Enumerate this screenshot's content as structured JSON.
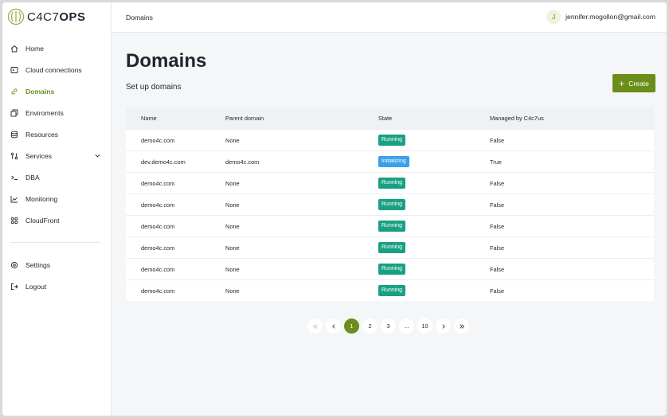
{
  "brand": {
    "name_bold_start": "C4C7",
    "name_bold_end": "OPS",
    "accent": "#6b8e1a"
  },
  "sidebar": {
    "items": [
      {
        "label": "Home",
        "icon": "home-icon"
      },
      {
        "label": "Cloud connections",
        "icon": "cloud-connection-icon"
      },
      {
        "label": "Domains",
        "icon": "link-icon",
        "active": true
      },
      {
        "label": "Enviroments",
        "icon": "environments-icon"
      },
      {
        "label": "Resources",
        "icon": "database-icon"
      },
      {
        "label": "Services",
        "icon": "services-icon",
        "expandable": true
      },
      {
        "label": "DBA",
        "icon": "terminal-icon"
      },
      {
        "label": "Monitoring",
        "icon": "chart-line-icon"
      },
      {
        "label": "CloudFront",
        "icon": "grid-icon"
      }
    ],
    "bottom_items": [
      {
        "label": "Settings",
        "icon": "gear-icon"
      },
      {
        "label": "Logout",
        "icon": "logout-icon"
      }
    ]
  },
  "topbar": {
    "breadcrumb": "Domains",
    "user": {
      "initial": "J",
      "email": "jennifer.mogollon@gmail.com"
    }
  },
  "page": {
    "title": "Domains",
    "subtitle": "Set up domains",
    "create_label": "Create"
  },
  "table": {
    "columns": [
      "Name",
      "Parent domain",
      "State",
      "Managed by C4c7us"
    ],
    "rows": [
      {
        "name": "demo4c.com",
        "parent": "None",
        "state": "Running",
        "managed": "False"
      },
      {
        "name": "dev.demo4c.com",
        "parent": "demo4c.com",
        "state": "Initializing",
        "managed": "True"
      },
      {
        "name": "demo4c.com",
        "parent": "None",
        "state": "Running",
        "managed": "False"
      },
      {
        "name": "demo4c.com",
        "parent": "None",
        "state": "Running",
        "managed": "False"
      },
      {
        "name": "demo4c.com",
        "parent": "None",
        "state": "Running",
        "managed": "False"
      },
      {
        "name": "demo4c.com",
        "parent": "None",
        "state": "Running",
        "managed": "False"
      },
      {
        "name": "demo4c.com",
        "parent": "None",
        "state": "Running",
        "managed": "False"
      },
      {
        "name": "demo4c.com",
        "parent": "None",
        "state": "Running",
        "managed": "False"
      }
    ],
    "status_colors": {
      "Running": "#19a082",
      "Initializing": "#3aa0e8"
    }
  },
  "pagination": {
    "pages": [
      "1",
      "2",
      "3",
      "...",
      "10"
    ],
    "current": "1"
  }
}
